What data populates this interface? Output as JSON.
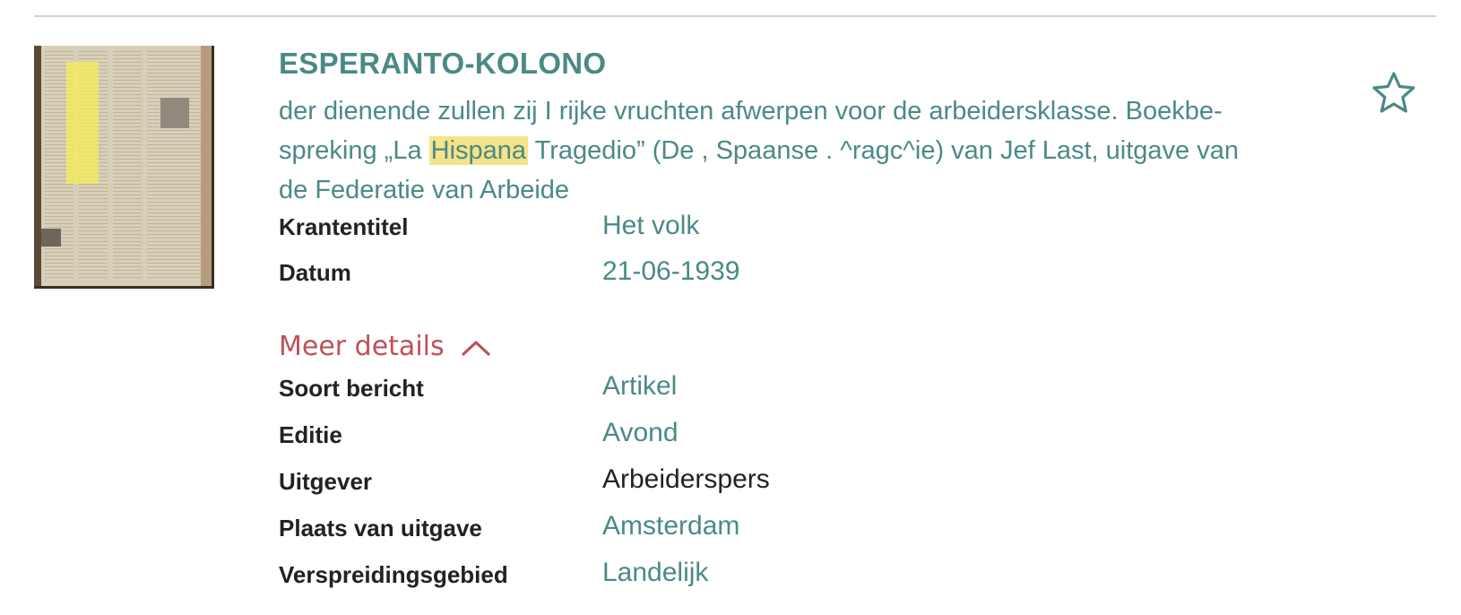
{
  "result": {
    "title": "ESPERANTO-KOLONO",
    "snippet": {
      "line1": "der dienende zullen zij I rijke vruchten afwerpen voor de arbeidersklasse. Boekbe-",
      "line2_before": "spreking „La ",
      "line2_highlight": "Hispana",
      "line2_after": " Tragedio” (De , Spaanse . ^ragc^ie) van Jef Last, uitgave van",
      "line3": "de Federatie van Arbeide"
    },
    "highlight_color": "#f5e389",
    "accent_color": "#4a8a86",
    "link_color": "#c0505a",
    "favorite_icon": "star-outline-icon"
  },
  "details": {
    "krantentitel": {
      "label": "Krantentitel",
      "value": "Het volk"
    },
    "datum": {
      "label": "Datum",
      "value": "21-06-1939"
    }
  },
  "meer_details": {
    "label": "Meer details",
    "icon": "chevron-up-icon"
  },
  "extra_details": [
    {
      "label": "Soort bericht",
      "value": "Artikel"
    },
    {
      "label": "Editie",
      "value": "Avond"
    },
    {
      "label": "Uitgever",
      "value": "Arbeiderspers"
    },
    {
      "label": "Plaats van uitgave",
      "value": "Amsterdam"
    },
    {
      "label": "Verspreidingsgebied",
      "value": "Landelijk"
    }
  ]
}
